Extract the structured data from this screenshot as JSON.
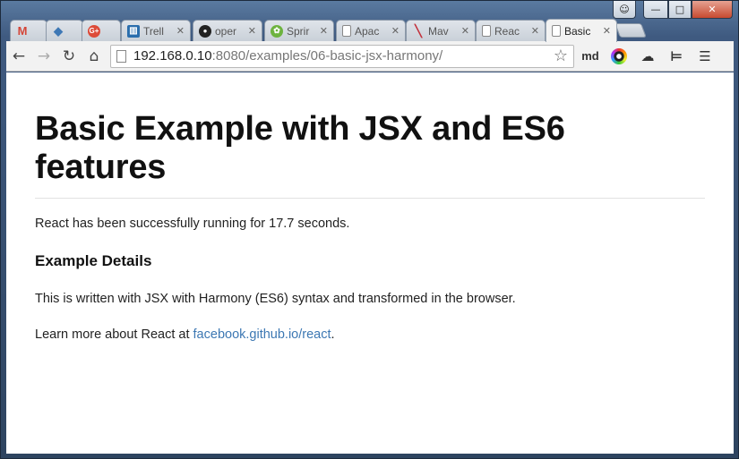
{
  "browser": {
    "tabs": [
      {
        "favicon": "gmail-icon",
        "fav_text": "M",
        "fav_color": "#d44638",
        "title": ""
      },
      {
        "favicon": "diamond-icon",
        "fav_text": "◆",
        "fav_color": "#3e78b5",
        "title": ""
      },
      {
        "favicon": "google-plus-icon",
        "fav_text": "G+",
        "fav_color": "#dd4b39",
        "title": ""
      },
      {
        "favicon": "trello-icon",
        "fav_text": "▥",
        "fav_color": "#2a6ead",
        "title": "Trell"
      },
      {
        "favicon": "github-icon",
        "fav_text": "●",
        "fav_color": "#222222",
        "title": "oper"
      },
      {
        "favicon": "spring-icon",
        "fav_text": "✿",
        "fav_color": "#6db33f",
        "title": "Sprir"
      },
      {
        "favicon": "page-icon",
        "fav_text": "",
        "fav_color": "",
        "title": "Apac"
      },
      {
        "favicon": "maven-icon",
        "fav_text": "╲",
        "fav_color": "#c3313b",
        "title": "Mav"
      },
      {
        "favicon": "page-icon",
        "fav_text": "",
        "fav_color": "",
        "title": "Reac"
      },
      {
        "favicon": "page-icon",
        "fav_text": "",
        "fav_color": "",
        "title": "Basic"
      }
    ],
    "url_host": "192.168.0.10",
    "url_rest": ":8080/examples/06-basic-jsx-harmony/",
    "ext_md_label": "md"
  },
  "page": {
    "heading": "Basic Example with JSX and ES6 features",
    "status_text": "React has been successfully running for 17.7 seconds.",
    "details_heading": "Example Details",
    "description": "This is written with JSX with Harmony (ES6) syntax and transformed in the browser.",
    "learn_more_prefix": "Learn more about React at ",
    "learn_more_link": "facebook.github.io/react",
    "learn_more_suffix": "."
  },
  "colors": {
    "link": "#3d78b3",
    "frame": "#3f5a80",
    "close_button": "#c74a30"
  }
}
